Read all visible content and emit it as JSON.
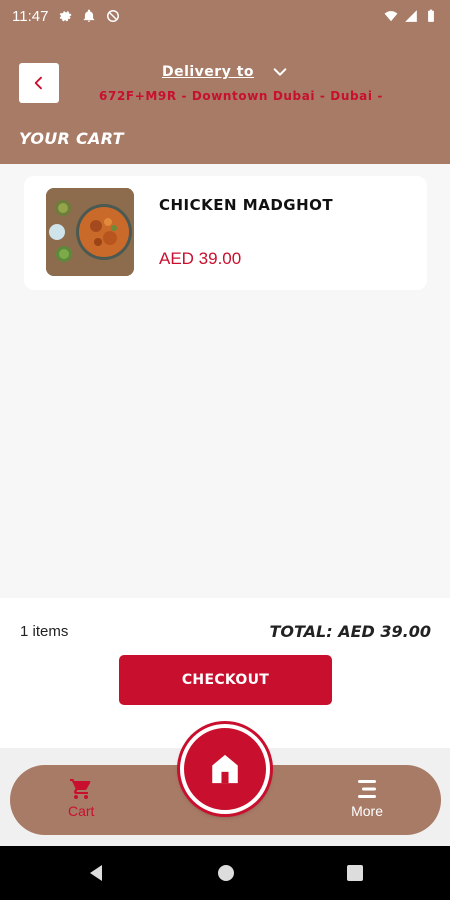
{
  "status_bar": {
    "time": "11:47",
    "icons": [
      "settings-gear-icon",
      "notification-bell-icon",
      "no-disturb-icon",
      "wifi-icon",
      "signal-icon",
      "battery-icon"
    ]
  },
  "header": {
    "delivery_label": "Delivery to",
    "address": "672F+M9R - Downtown Dubai - Dubai -",
    "page_title": "YOUR CART",
    "back_icon": "chevron-left-icon"
  },
  "cart": {
    "items": [
      {
        "name": "CHICKEN MADGHOT",
        "price": "AED 39.00",
        "image": "chicken-madghot-dish"
      }
    ]
  },
  "summary": {
    "items_count": "1 items",
    "total": "TOTAL: AED 39.00",
    "checkout_label": "CHECKOUT"
  },
  "tab_bar": {
    "cart_label": "Cart",
    "more_label": "More"
  },
  "colors": {
    "brand_brown": "#a87b66",
    "accent_red": "#c8102e"
  }
}
